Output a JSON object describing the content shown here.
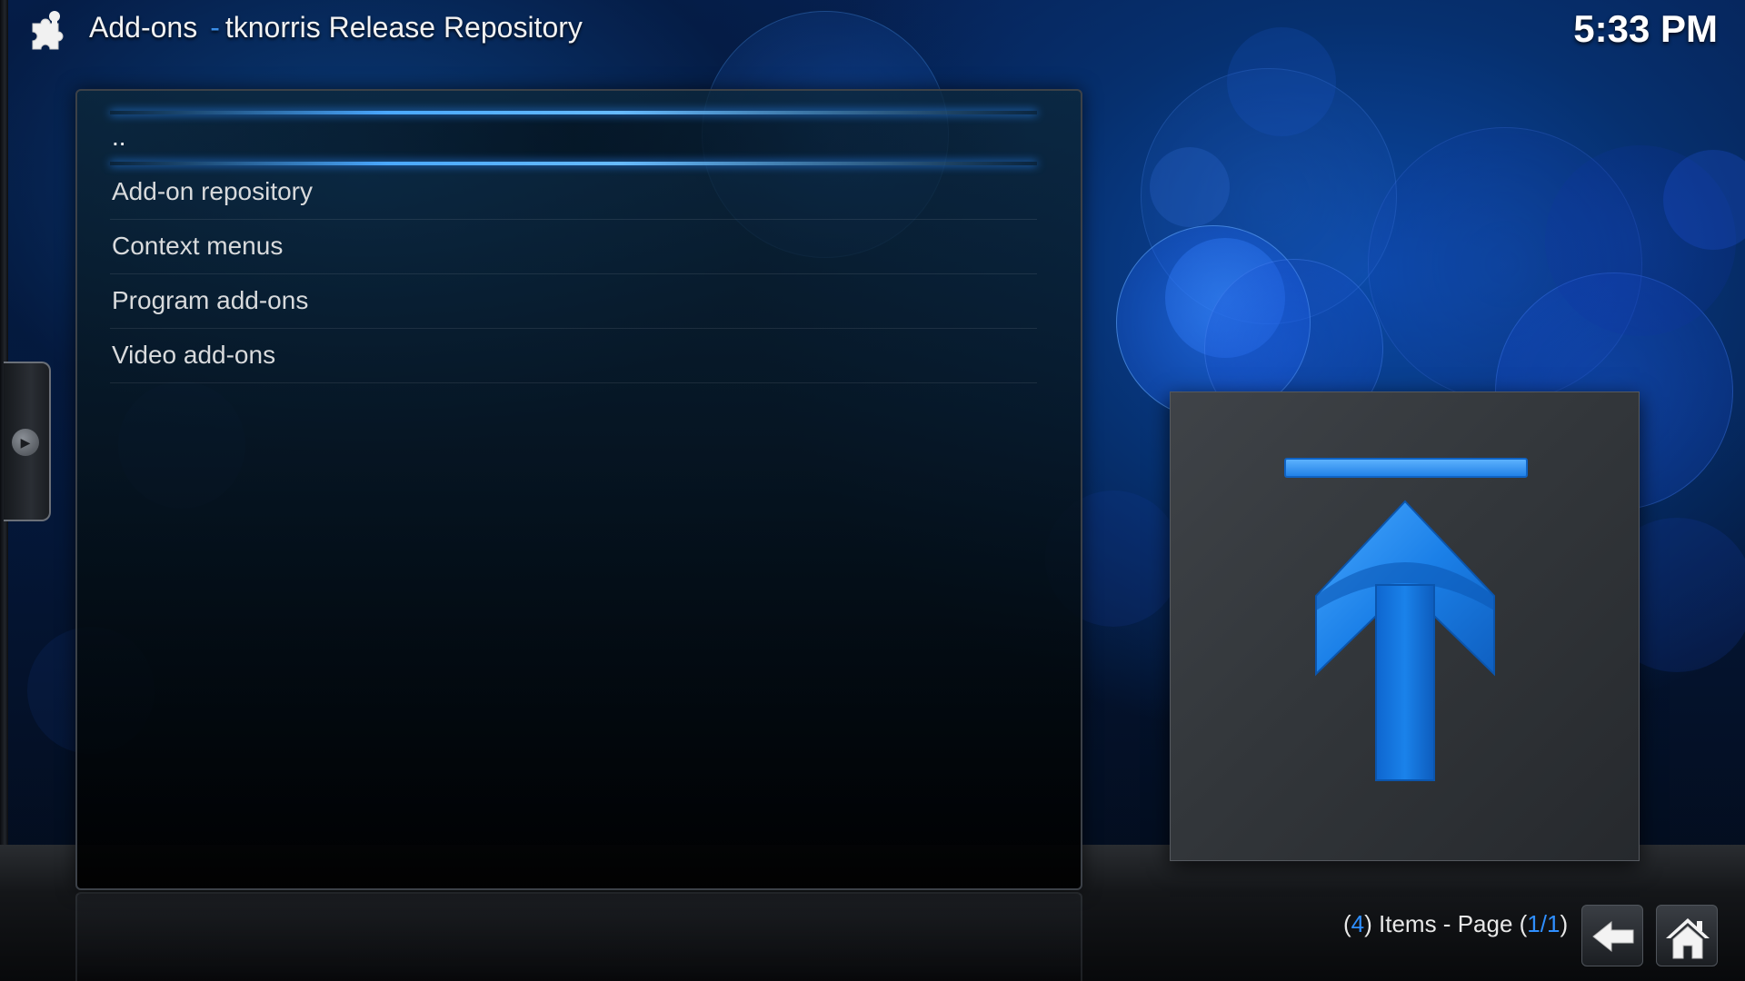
{
  "header": {
    "section": "Add-ons",
    "separator": "-",
    "subtitle": "tknorris Release Repository"
  },
  "clock": "5:33 PM",
  "list": {
    "items": [
      {
        "label": "..",
        "focused": true
      },
      {
        "label": "Add-on repository",
        "focused": false
      },
      {
        "label": "Context menus",
        "focused": false
      },
      {
        "label": "Program add-ons",
        "focused": false
      },
      {
        "label": "Video add-ons",
        "focused": false
      }
    ]
  },
  "footer": {
    "open_paren": "(",
    "count": "4",
    "items_text": ") Items - Page (",
    "page": "1/1",
    "close_paren": ")"
  },
  "icons": {
    "header": "puzzle-piece-icon",
    "thumbnail": "upload-arrow-icon",
    "back": "back-arrow-icon",
    "home": "home-icon",
    "side_tab": "play-arrow-icon"
  },
  "colors": {
    "accent": "#2f8fff",
    "text": "#d8dadc"
  }
}
